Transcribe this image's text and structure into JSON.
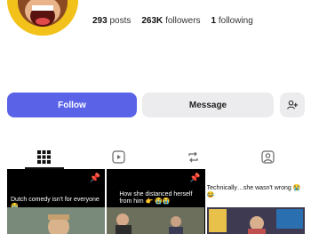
{
  "profile": {
    "avatar_icon": "cartoon-monkey-avatar"
  },
  "stats": {
    "posts_count": "293",
    "posts_label": "posts",
    "followers_count": "263K",
    "followers_label": "followers",
    "following_count": "1",
    "following_label": "following"
  },
  "actions": {
    "follow_label": "Follow",
    "message_label": "Message",
    "add_user_icon": "add-user-icon"
  },
  "tabs": [
    {
      "icon": "grid-icon",
      "active": true
    },
    {
      "icon": "reels-icon",
      "active": false
    },
    {
      "icon": "repost-icon",
      "active": false
    },
    {
      "icon": "tagged-icon",
      "active": false
    }
  ],
  "posts": [
    {
      "caption": "Dutch comedy isn't for everyone 😭",
      "pinned": true
    },
    {
      "caption": "How she distanced herself from him 👉 😭😭",
      "pinned": true
    },
    {
      "caption": "Technically…she wasn't wrong 😭😂",
      "pinned": false
    }
  ],
  "colors": {
    "accent": "#5a63e8",
    "secondary_button": "#ececee"
  }
}
